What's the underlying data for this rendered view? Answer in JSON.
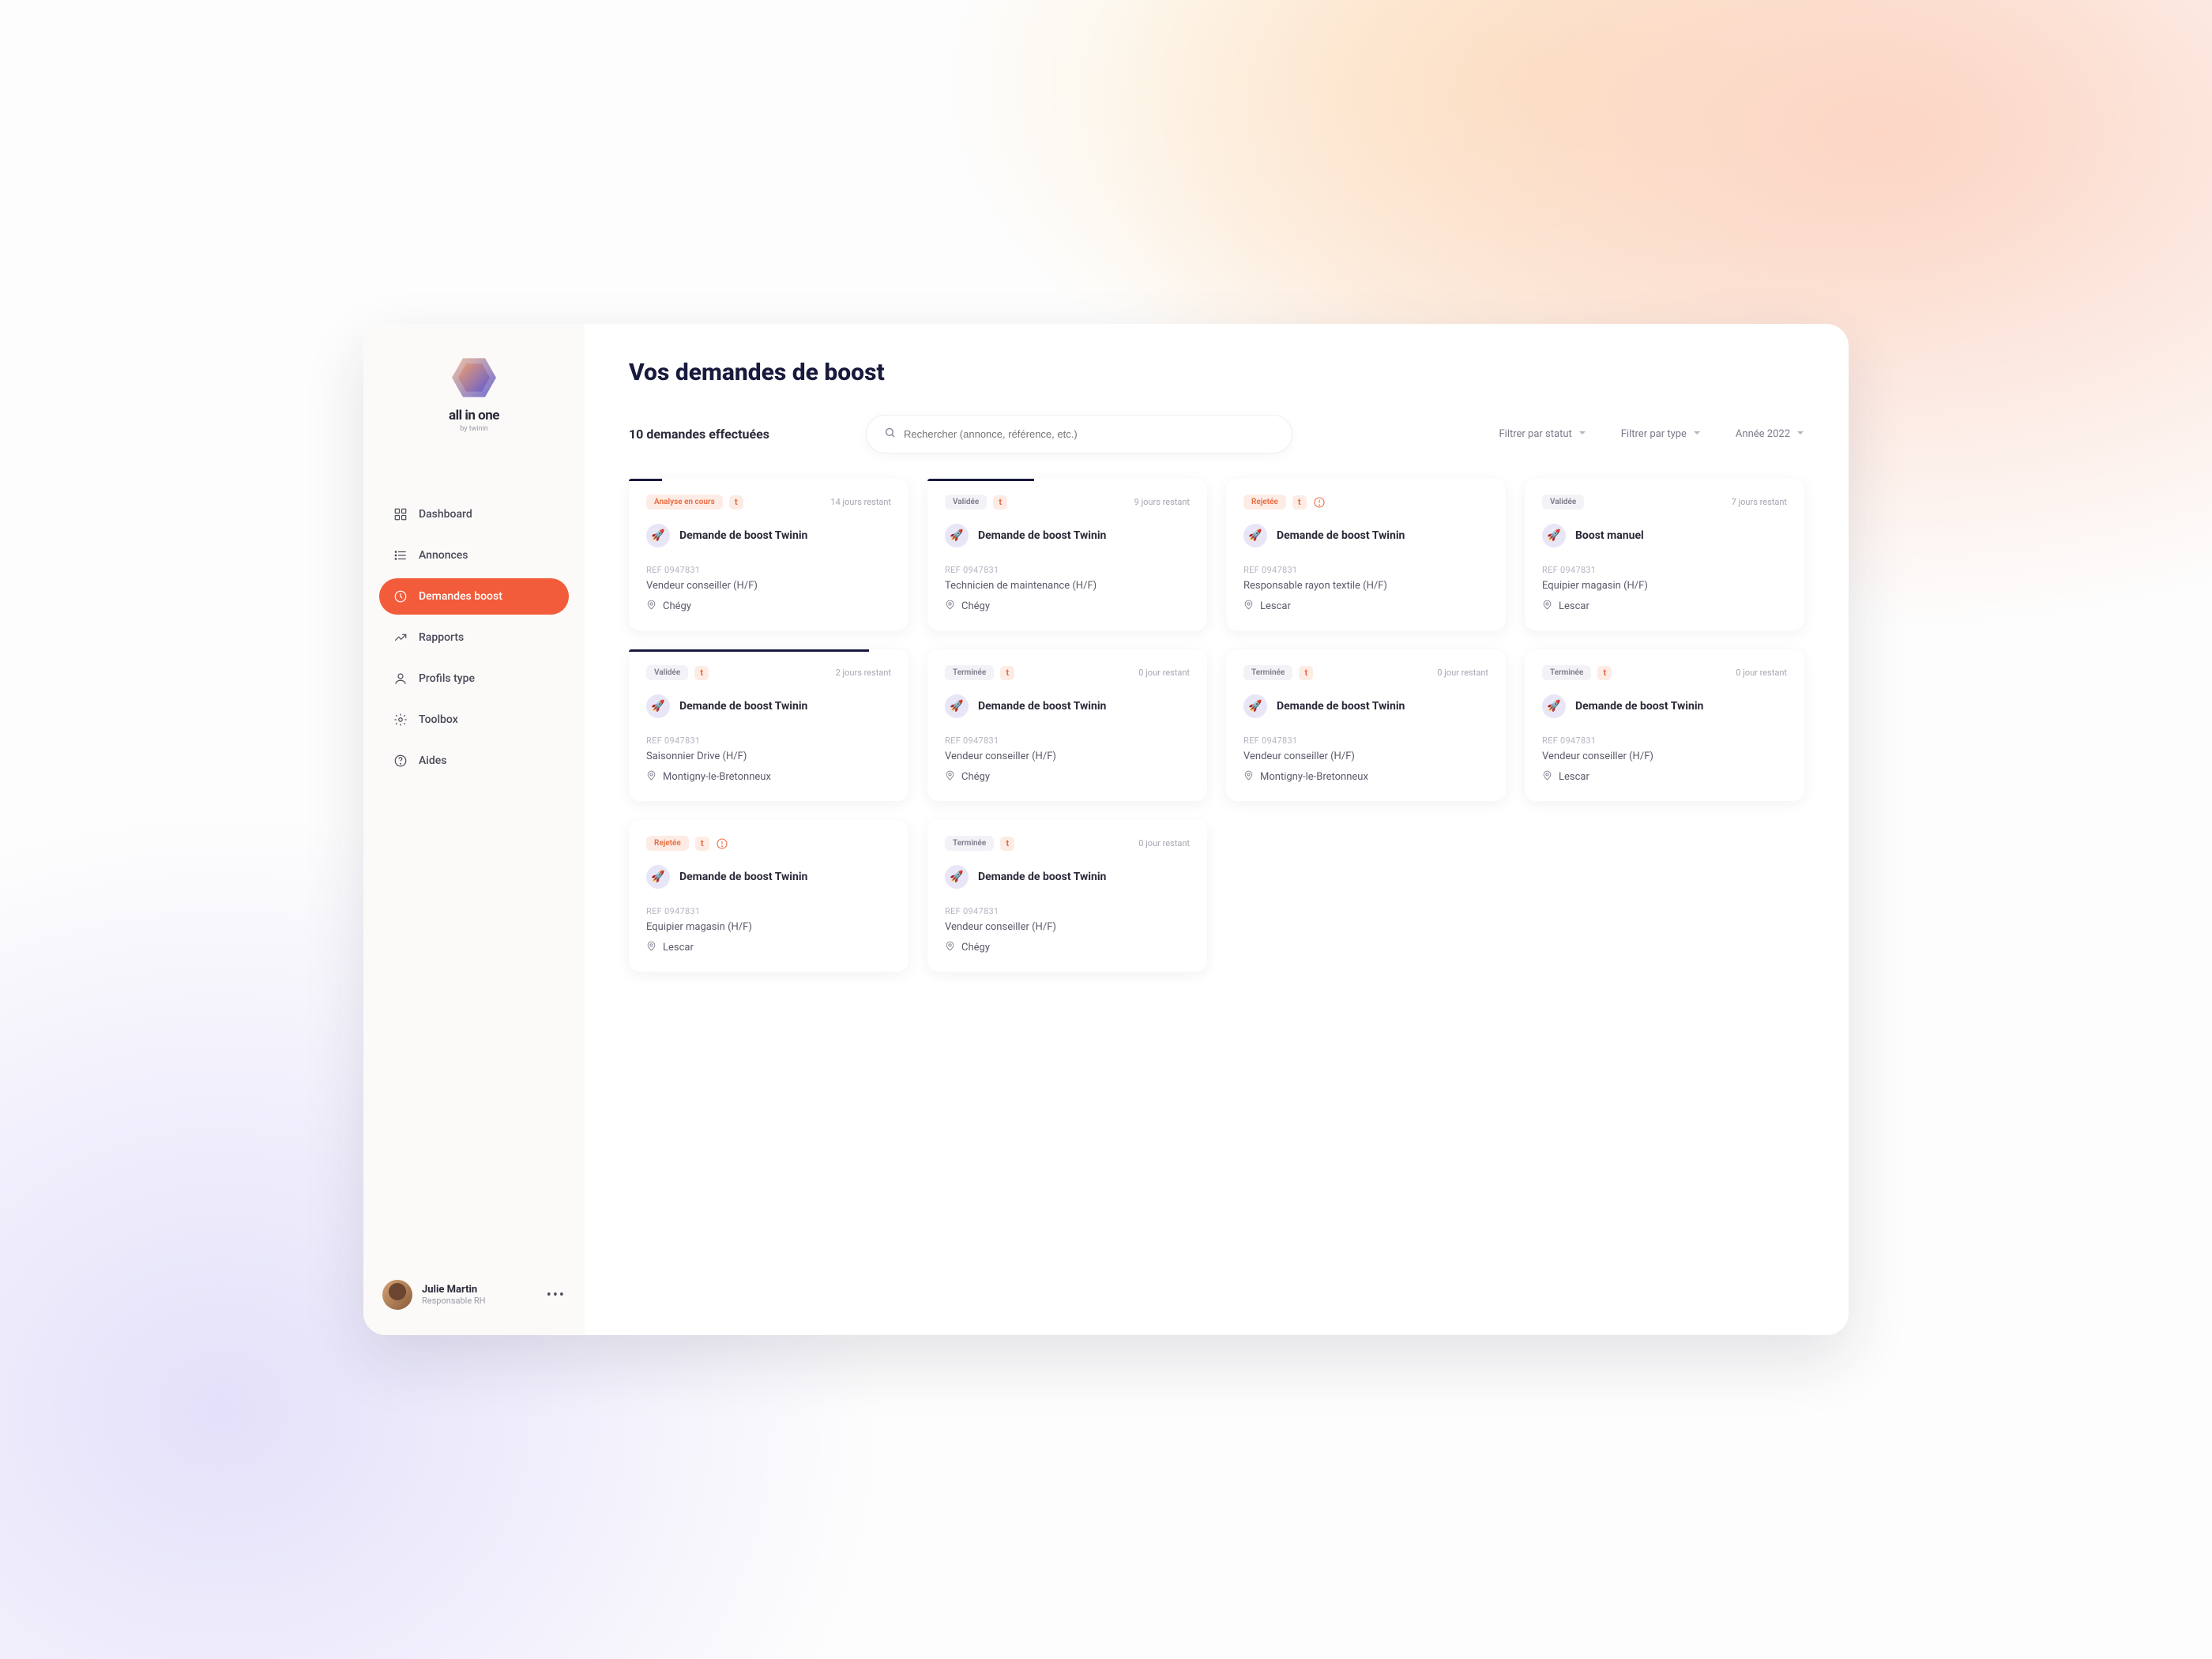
{
  "brand": {
    "name": "all in one",
    "sub": "by twinin"
  },
  "nav": [
    {
      "label": "Dashboard"
    },
    {
      "label": "Annonces"
    },
    {
      "label": "Demandes boost"
    },
    {
      "label": "Rapports"
    },
    {
      "label": "Profils type"
    },
    {
      "label": "Toolbox"
    },
    {
      "label": "Aides"
    }
  ],
  "user": {
    "name": "Julie Martin",
    "role": "Responsable RH"
  },
  "page": {
    "title": "Vos demandes de boost",
    "count": "10 demandes effectuées",
    "search_placeholder": "Rechercher (annonce, référence, etc.)"
  },
  "filters": {
    "status": "Filtrer par statut",
    "type": "Filtrer par type",
    "year": "Année 2022"
  },
  "cards": [
    {
      "status": "Analyse en cours",
      "status_class": "status-analyse",
      "show_t": true,
      "show_warn": false,
      "days": "14 jours restant",
      "progress": 12,
      "title": "Demande de boost Twinin",
      "ref": "REF 0947831",
      "job": "Vendeur conseiller (H/F)",
      "location": "Chégy"
    },
    {
      "status": "Validée",
      "status_class": "status-validee",
      "show_t": true,
      "show_warn": false,
      "days": "9 jours restant",
      "progress": 38,
      "title": "Demande de boost Twinin",
      "ref": "REF 0947831",
      "job": "Technicien de maintenance (H/F)",
      "location": "Chégy"
    },
    {
      "status": "Rejetée",
      "status_class": "status-rejetee",
      "show_t": true,
      "show_warn": true,
      "days": "",
      "progress": 0,
      "title": "Demande de boost Twinin",
      "ref": "REF 0947831",
      "job": "Responsable rayon textile (H/F)",
      "location": "Lescar"
    },
    {
      "status": "Validée",
      "status_class": "status-validee",
      "show_t": false,
      "show_warn": false,
      "days": "7 jours restant",
      "progress": 0,
      "title": "Boost manuel",
      "ref": "REF 0947831",
      "job": "Equipier magasin (H/F)",
      "location": "Lescar"
    },
    {
      "status": "Validée",
      "status_class": "status-validee",
      "show_t": true,
      "show_warn": false,
      "days": "2 jours restant",
      "progress": 86,
      "title": "Demande de boost Twinin",
      "ref": "REF 0947831",
      "job": "Saisonnier Drive (H/F)",
      "location": "Montigny-le-Bretonneux"
    },
    {
      "status": "Terminée",
      "status_class": "status-terminee",
      "show_t": true,
      "show_warn": false,
      "days": "0 jour restant",
      "progress": 0,
      "title": "Demande de boost Twinin",
      "ref": "REF 0947831",
      "job": "Vendeur conseiller (H/F)",
      "location": "Chégy"
    },
    {
      "status": "Terminée",
      "status_class": "status-terminee",
      "show_t": true,
      "show_warn": false,
      "days": "0 jour restant",
      "progress": 0,
      "title": "Demande de boost Twinin",
      "ref": "REF 0947831",
      "job": "Vendeur conseiller (H/F)",
      "location": "Montigny-le-Bretonneux"
    },
    {
      "status": "Terminée",
      "status_class": "status-terminee",
      "show_t": true,
      "show_warn": false,
      "days": "0 jour restant",
      "progress": 0,
      "title": "Demande de boost Twinin",
      "ref": "REF 0947831",
      "job": "Vendeur conseiller (H/F)",
      "location": "Lescar"
    },
    {
      "status": "Rejetée",
      "status_class": "status-rejetee",
      "show_t": true,
      "show_warn": true,
      "days": "",
      "progress": 0,
      "title": "Demande de boost Twinin",
      "ref": "REF 0947831",
      "job": "Equipier magasin (H/F)",
      "location": "Lescar"
    },
    {
      "status": "Terminée",
      "status_class": "status-terminee",
      "show_t": true,
      "show_warn": false,
      "days": "0 jour restant",
      "progress": 0,
      "title": "Demande de boost Twinin",
      "ref": "REF 0947831",
      "job": "Vendeur conseiller (H/F)",
      "location": "Chégy"
    }
  ]
}
